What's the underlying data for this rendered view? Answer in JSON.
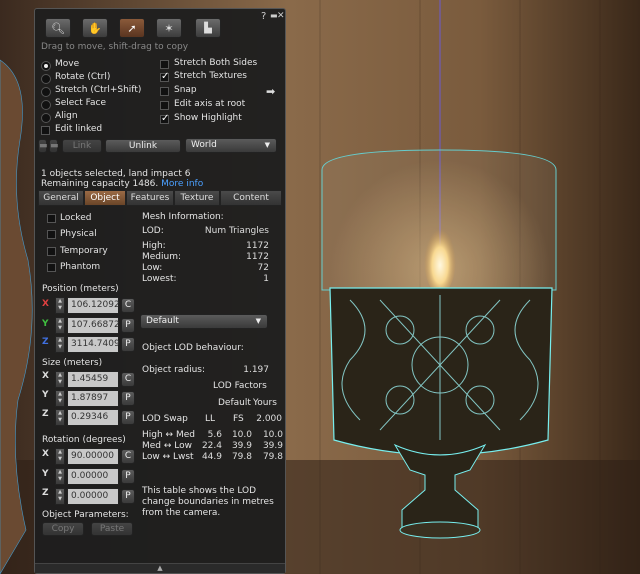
{
  "toolbar": {
    "tools": [
      "focus-icon",
      "move-icon",
      "edit-icon",
      "create-icon",
      "land-icon"
    ],
    "help": "?",
    "minimize": "▬",
    "close": "✕"
  },
  "hint": "Drag to move, shift-drag to copy",
  "modes": [
    "Move",
    "Rotate (Ctrl)",
    "Stretch (Ctrl+Shift)",
    "Select Face",
    "Align"
  ],
  "edit_linked": "Edit linked",
  "options": {
    "stretch_both_sides": "Stretch Both Sides",
    "stretch_textures": "Stretch Textures",
    "snap": "Snap",
    "edit_axis_at_root": "Edit axis at root",
    "show_highlight": "Show Highlight"
  },
  "link_label": "Link",
  "unlink_label": "Unlink",
  "ruler_mode": "World",
  "selection": {
    "line1": "1 objects selected, land impact 6",
    "line2": "Remaining capacity 1486.",
    "more_info": "More info"
  },
  "tabs": [
    "General",
    "Object",
    "Features",
    "Texture",
    "Content"
  ],
  "object": {
    "locked": "Locked",
    "physical": "Physical",
    "temporary": "Temporary",
    "phantom": "Phantom",
    "position_label": "Position (meters)",
    "position": [
      "106.12092",
      "107.66872",
      "3114.7409"
    ],
    "size_label": "Size (meters)",
    "size": [
      "1.45459",
      "1.87897",
      "0.29346"
    ],
    "rotation_label": "Rotation (degrees)",
    "rotation": [
      "90.00000",
      "0.00000",
      "0.00000"
    ],
    "params_label": "Object Parameters:",
    "copy": "Copy",
    "paste": "Paste",
    "axes": [
      "X",
      "Y",
      "Z"
    ],
    "c": "C",
    "p": "P"
  },
  "mesh": {
    "title": "Mesh Information:",
    "lod_header": "LOD:",
    "tri_header": "Num Triangles",
    "rows": [
      {
        "label": "High:",
        "value": "1172"
      },
      {
        "label": "Medium:",
        "value": "1172"
      },
      {
        "label": "Low:",
        "value": "72"
      },
      {
        "label": "Lowest:",
        "value": "1"
      }
    ],
    "dropdown": "Default",
    "lod_behaviour": "Object LOD behaviour:",
    "radius_label": "Object radius:",
    "radius": "1.197",
    "factors_title": "LOD Factors",
    "col_default": "Default",
    "col_yours": "Yours",
    "swap_label": "LOD Swap",
    "col_ll": "LL",
    "col_fs": "FS",
    "swap_val": "2.000",
    "swap_rows": [
      {
        "label": "High ↔ Med",
        "v": [
          "5.6",
          "10.0",
          "10.0"
        ]
      },
      {
        "label": "Med ↔ Low",
        "v": [
          "22.4",
          "39.9",
          "39.9"
        ]
      },
      {
        "label": "Low ↔ Lwst",
        "v": [
          "44.9",
          "79.8",
          "79.8"
        ]
      }
    ],
    "note": "This table shows the LOD change boundaries in metres from the camera."
  },
  "colors": {
    "axis_x": "#e04040",
    "axis_y": "#40c040",
    "axis_z": "#4070e0",
    "link_blue": "#4ba0ff"
  }
}
